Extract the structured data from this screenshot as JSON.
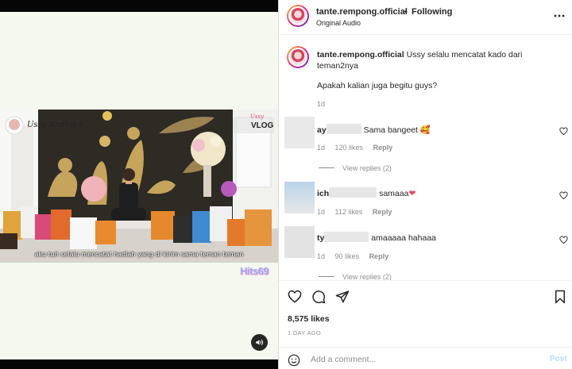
{
  "post": {
    "username": "tante.rempong.official",
    "separator": "•",
    "follow_status": "Following",
    "audio": "Original Audio"
  },
  "video": {
    "creator_overlay": "Ussy Andhika",
    "vlog_tag": "Ussy",
    "vlog_label": "VLOG",
    "subtitle": "aku tuh selalu mencatat hadiah yang di kirim sama teman teman",
    "watermark": "Hits69"
  },
  "caption": {
    "username": "tante.rempong.official",
    "text": "Ussy selalu mencatat kado dari teman2nya",
    "extra": "Apakah kalian juga begitu guys?",
    "time": "1d"
  },
  "comments": [
    {
      "user_visible": "ay",
      "text": "Sama bangeet",
      "emoji": "🥰",
      "time": "1d",
      "likes": "120 likes",
      "reply": "Reply",
      "view_replies": "View replies (2)"
    },
    {
      "user_visible": "ich",
      "text": "samaaa",
      "emoji": "❤",
      "time": "1d",
      "likes": "112 likes",
      "reply": "Reply"
    },
    {
      "user_visible": "ty",
      "text": "amaaaaa hahaaa",
      "emoji": "",
      "time": "1d",
      "likes": "90 likes",
      "reply": "Reply",
      "view_replies": "View replies (2)"
    }
  ],
  "stats": {
    "likes": "8,575 likes",
    "ago": "1 DAY AGO"
  },
  "composer": {
    "placeholder": "Add a comment...",
    "post_label": "Post"
  },
  "icons": [
    "more-icon",
    "sound-icon",
    "heart-icon",
    "comment-icon",
    "share-icon",
    "save-icon",
    "emoji-icon"
  ],
  "colors": {
    "accent_link": "#b3dbff",
    "muted": "#8e8e8e",
    "text": "#262626",
    "heart_red": "#ed4956"
  }
}
